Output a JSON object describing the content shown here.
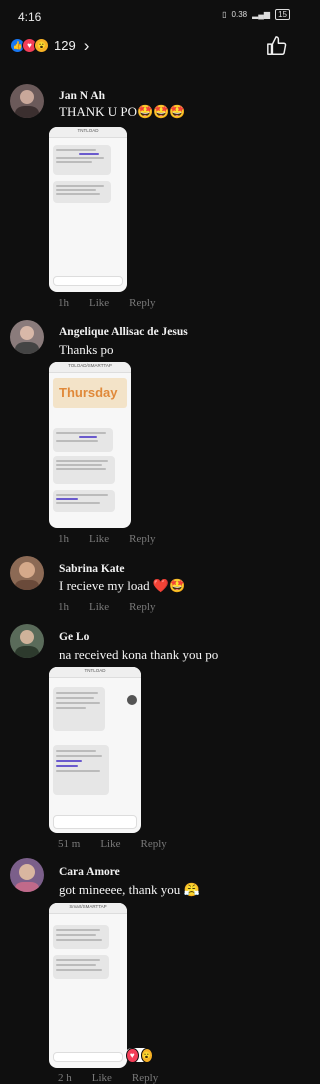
{
  "status_bar": {
    "time": "4:16",
    "net": "0.38",
    "battery": "15"
  },
  "reactions": {
    "count": "129"
  },
  "comments": [
    {
      "name": "Jan N Ah",
      "text": "THANK U PO🤩🤩🤩",
      "time": "1h",
      "like": "Like",
      "reply": "Reply",
      "shot_title": "TNTLOAD",
      "avatar_color": "#6b5a5a"
    },
    {
      "name": "Angelique Allisac de Jesus",
      "text": "Thanks po",
      "time": "1h",
      "like": "Like",
      "reply": "Reply",
      "shot_title": "TOLOAD/SMARTTAP",
      "shot_banner": "Thursday",
      "avatar_color": "#8a7b7b"
    },
    {
      "name": "Sabrina Kate",
      "text": "I recieve my load ❤️🤩",
      "time": "1h",
      "like": "Like",
      "reply": "Reply",
      "avatar_color": "#8c6a55"
    },
    {
      "name": "Ge Lo",
      "text": "na received kona thank you po",
      "time": "51 m",
      "like": "Like",
      "reply": "Reply",
      "shot_title": "TNTLOAD",
      "avatar_color": "#5a6b5a"
    },
    {
      "name": "Cara Amore",
      "text": "got mineeee, thank you 😤",
      "time": "2 h",
      "like": "Like",
      "reply": "Reply",
      "shot_title": "Smart/SMARTTAP",
      "avatar_color": "#7b5f8a"
    }
  ]
}
